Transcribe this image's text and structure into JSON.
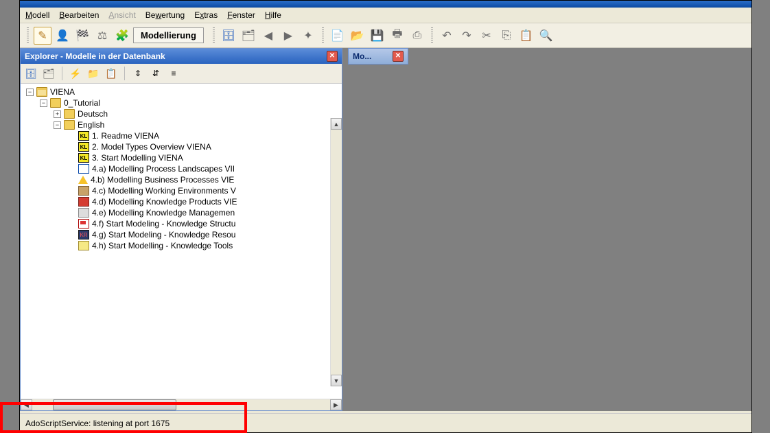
{
  "menubar": [
    {
      "html": "<u>M</u>odell"
    },
    {
      "html": "<u>B</u>earbeiten"
    },
    {
      "html": "<u>A</u>nsicht"
    },
    {
      "html": "Be<u>w</u>ertung"
    },
    {
      "html": "E<u>x</u>tras"
    },
    {
      "html": "<u>F</u>enster"
    },
    {
      "html": "<u>H</u>ilfe"
    }
  ],
  "toolbar_label": "Modellierung",
  "explorer": {
    "title": "Explorer - Modelle in der Datenbank"
  },
  "mo_panel": {
    "title": "Mo..."
  },
  "tree": {
    "root": "VIENA",
    "tutorial": "0_Tutorial",
    "deutsch": "Deutsch",
    "english": "English",
    "items": [
      "1. Readme VIENA",
      "2. Model Types Overview VIENA",
      "3. Start Modelling VIENA",
      "4.a) Modelling Process Landscapes VII",
      "4.b) Modelling Business Processes VIE",
      "4.c) Modelling Working Environments V",
      "4.d) Modelling Knowledge Products VIE",
      "4.e) Modelling Knowledge Managemen",
      "4.f) Start Modeling - Knowledge Structu",
      "4.g) Start Modeling - Knowledge Resou",
      "4.h) Start Modelling - Knowledge Tools"
    ]
  },
  "status": "AdoScriptService: listening at port 1675"
}
